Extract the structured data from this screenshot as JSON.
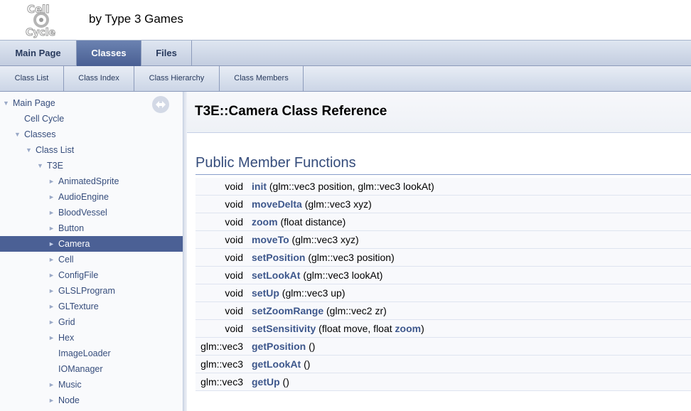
{
  "header": {
    "logo_text": "Cell Cycle",
    "brief": "by Type 3 Games"
  },
  "tabs": [
    {
      "label": "Main Page",
      "active": false
    },
    {
      "label": "Classes",
      "active": true
    },
    {
      "label": "Files",
      "active": false
    }
  ],
  "subtabs": [
    {
      "label": "Class List"
    },
    {
      "label": "Class Index"
    },
    {
      "label": "Class Hierarchy"
    },
    {
      "label": "Class Members"
    }
  ],
  "sidebar": {
    "sync_icon": "sync-icon",
    "items": [
      {
        "label": "Main Page",
        "arrow": "▼",
        "selected": false
      },
      {
        "label": "Cell Cycle",
        "arrow": "",
        "selected": false
      },
      {
        "label": "Classes",
        "arrow": "▼",
        "selected": false
      },
      {
        "label": "Class List",
        "arrow": "▼",
        "selected": false
      },
      {
        "label": "T3E",
        "arrow": "▼",
        "selected": false
      },
      {
        "label": "AnimatedSprite",
        "arrow": "►",
        "selected": false
      },
      {
        "label": "AudioEngine",
        "arrow": "►",
        "selected": false
      },
      {
        "label": "BloodVessel",
        "arrow": "►",
        "selected": false
      },
      {
        "label": "Button",
        "arrow": "►",
        "selected": false
      },
      {
        "label": "Camera",
        "arrow": "►",
        "selected": true
      },
      {
        "label": "Cell",
        "arrow": "►",
        "selected": false
      },
      {
        "label": "ConfigFile",
        "arrow": "►",
        "selected": false
      },
      {
        "label": "GLSLProgram",
        "arrow": "►",
        "selected": false
      },
      {
        "label": "GLTexture",
        "arrow": "►",
        "selected": false
      },
      {
        "label": "Grid",
        "arrow": "►",
        "selected": false
      },
      {
        "label": "Hex",
        "arrow": "►",
        "selected": false
      },
      {
        "label": "ImageLoader",
        "arrow": "",
        "selected": false
      },
      {
        "label": "IOManager",
        "arrow": "",
        "selected": false
      },
      {
        "label": "Music",
        "arrow": "►",
        "selected": false
      },
      {
        "label": "Node",
        "arrow": "►",
        "selected": false
      }
    ]
  },
  "content": {
    "title": "T3E::Camera Class Reference",
    "section": "Public Member Functions",
    "members": [
      {
        "ret": "void",
        "name": "init",
        "args": " (glm::vec3 position, glm::vec3 lookAt)"
      },
      {
        "ret": "void",
        "name": "moveDelta",
        "args": " (glm::vec3 xyz)"
      },
      {
        "ret": "void",
        "name": "zoom",
        "args": " (float distance)"
      },
      {
        "ret": "void",
        "name": "moveTo",
        "args": " (glm::vec3 xyz)"
      },
      {
        "ret": "void",
        "name": "setPosition",
        "args": " (glm::vec3 position)"
      },
      {
        "ret": "void",
        "name": "setLookAt",
        "args": " (glm::vec3 lookAt)"
      },
      {
        "ret": "void",
        "name": "setUp",
        "args": " (glm::vec3 up)"
      },
      {
        "ret": "void",
        "name": "setZoomRange",
        "args": " (glm::vec2 zr)"
      },
      {
        "ret": "void",
        "name": "setSensitivity",
        "args": " (float move, float ",
        "link": "zoom",
        "tail": ")"
      },
      {
        "ret": "glm::vec3",
        "name": "getPosition",
        "args": " ()"
      },
      {
        "ret": "glm::vec3",
        "name": "getLookAt",
        "args": " ()"
      },
      {
        "ret": "glm::vec3",
        "name": "getUp",
        "args": " ()"
      }
    ]
  }
}
